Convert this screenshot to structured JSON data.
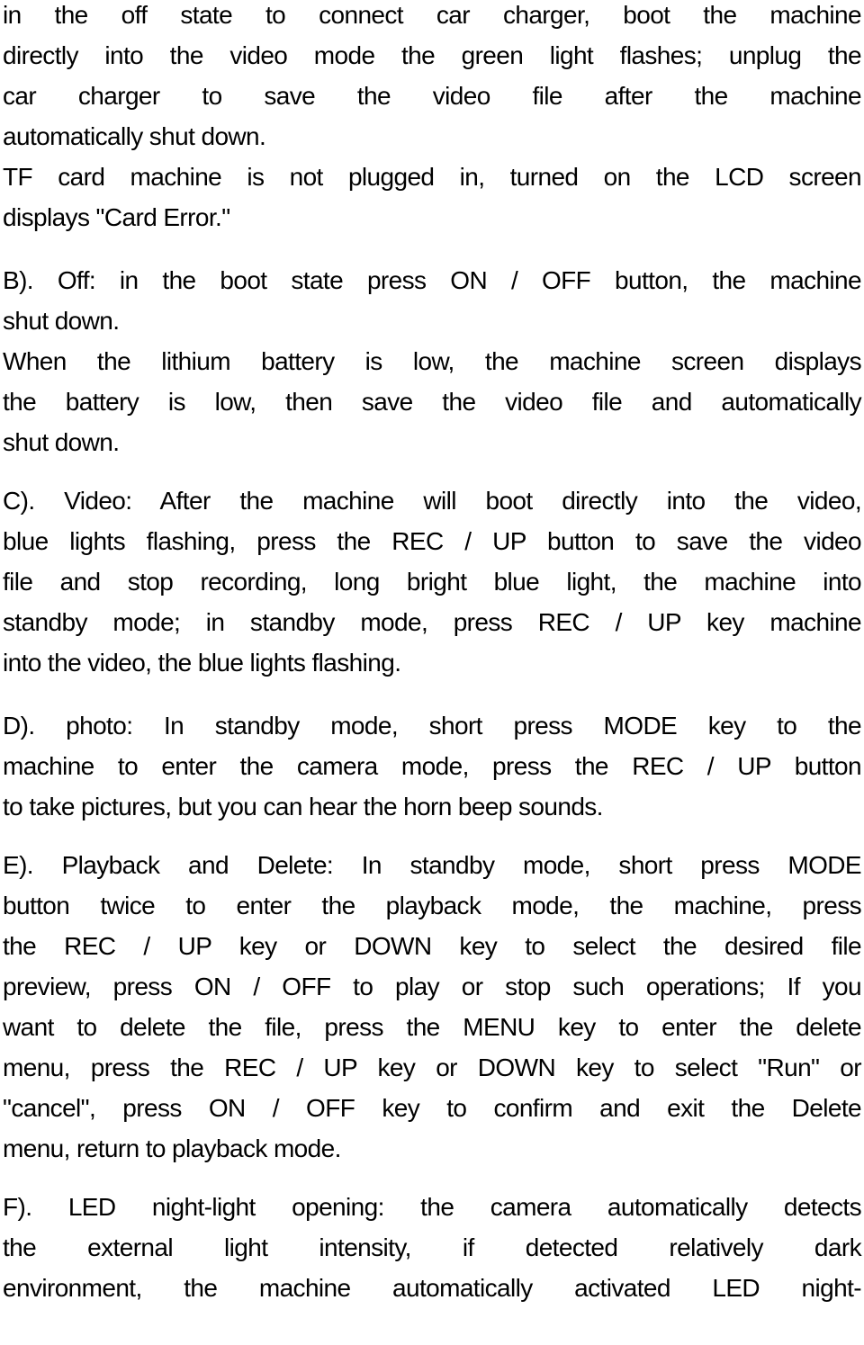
{
  "document": {
    "paragraphs": [
      {
        "id": "intro-car-charger",
        "lines": [
          {
            "text": "in the off state to connect car charger, boot the machine",
            "justify": true
          },
          {
            "text": "directly into the video mode the green light flashes; unplug the",
            "justify": true
          },
          {
            "text": "car charger to save the video file after the machine",
            "justify": true
          },
          {
            "text": "automatically shut down.",
            "justify": false
          }
        ]
      },
      {
        "id": "tf-card-error",
        "lines": [
          {
            "text": "TF card machine is not plugged in, turned on the LCD screen",
            "justify": true
          },
          {
            "text": "displays \"Card Error.\"",
            "justify": false
          }
        ]
      },
      {
        "id": "section-b-off",
        "lines": [
          {
            "text": "B). Off: in the boot state press ON / OFF button, the machine",
            "justify": true
          },
          {
            "text": "shut down.",
            "justify": false
          }
        ]
      },
      {
        "id": "low-battery",
        "lines": [
          {
            "text": "When the lithium battery is low, the machine screen displays",
            "justify": true
          },
          {
            "text": "the battery is low, then save the video file and automatically",
            "justify": true
          },
          {
            "text": "shut down.",
            "justify": false
          }
        ]
      },
      {
        "id": "section-c-video",
        "lines": [
          {
            "text": "C). Video: After the machine will boot directly into the video,",
            "justify": true
          },
          {
            "text": "blue lights flashing, press the REC / UP button to save the video",
            "justify": true
          },
          {
            "text": "file and stop recording, long bright blue light, the machine into",
            "justify": true
          },
          {
            "text": "standby mode; in standby mode, press REC / UP key machine",
            "justify": true
          },
          {
            "text": "into the video, the blue lights flashing.",
            "justify": false
          }
        ]
      },
      {
        "id": "section-d-photo",
        "lines": [
          {
            "text": "D). photo: In standby mode, short press MODE key to the",
            "justify": true
          },
          {
            "text": "machine to enter the camera mode, press the REC / UP button",
            "justify": true
          },
          {
            "text": "to take pictures, but you can hear the horn beep sounds.",
            "justify": false
          }
        ]
      },
      {
        "id": "section-e-playback-delete",
        "lines": [
          {
            "text": "E). Playback and Delete: In standby mode, short press MODE",
            "justify": true
          },
          {
            "text": "button twice to enter the playback mode, the machine, press",
            "justify": true
          },
          {
            "text": "the REC / UP key or DOWN key to select the desired file",
            "justify": true
          },
          {
            "text": "preview, press ON / OFF to play or stop such operations; If you",
            "justify": true
          },
          {
            "text": "want to delete the file, press the MENU key to enter the delete",
            "justify": true
          },
          {
            "text": "menu, press the REC / UP key or DOWN key to select \"Run\" or",
            "justify": true
          },
          {
            "text": "\"cancel\", press ON / OFF key to confirm and exit the Delete",
            "justify": true
          },
          {
            "text": "menu, return to playback mode.",
            "justify": false
          }
        ]
      },
      {
        "id": "section-f-led-night-light",
        "lines": [
          {
            "text": "F). LED night-light opening: the camera automatically detects",
            "justify": true
          },
          {
            "text": "the external light intensity, if detected relatively dark",
            "justify": true
          },
          {
            "text": "environment, the machine automatically activated LED night-",
            "justify": true
          }
        ]
      }
    ]
  }
}
